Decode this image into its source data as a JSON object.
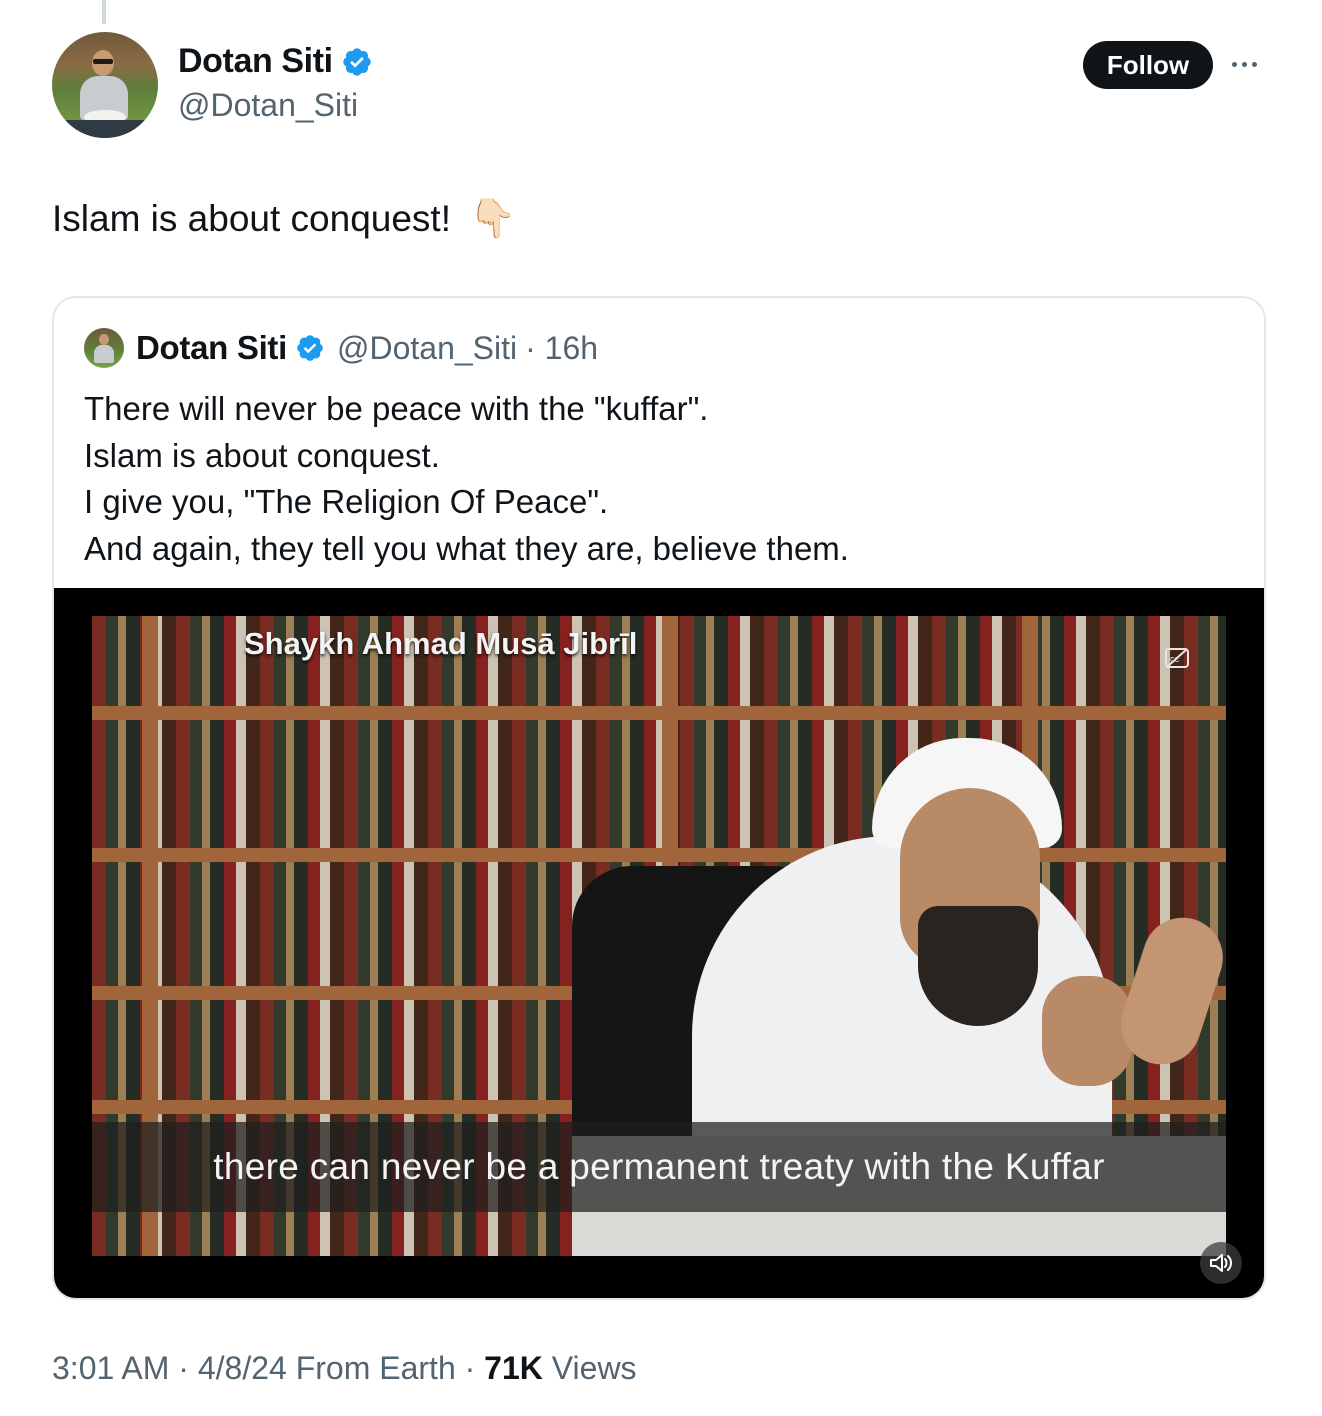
{
  "post": {
    "author": {
      "display_name": "Dotan Siti",
      "handle": "@Dotan_Siti"
    },
    "follow_label": "Follow",
    "text": "Islam is about conquest!",
    "emoji": "👇🏻"
  },
  "quoted": {
    "author": {
      "display_name": "Dotan Siti",
      "handle": "@Dotan_Siti",
      "age": "· 16h"
    },
    "lines": [
      "There will never be peace with the \"kuffar\".",
      "Islam is about conquest.",
      "I give you, \"The Religion Of Peace\".",
      "And again, they tell you what they are, believe them."
    ],
    "video": {
      "overlay_name": "Shaykh Ahmad Musā Jibrīl",
      "subtitle": "there can never be a permanent treaty with the Kuffar"
    }
  },
  "meta": {
    "time": "3:01 AM · 4/8/24 From Earth · ",
    "views_count": "71K",
    "views_label": " Views"
  },
  "colors": {
    "verified": "#1d9bf0",
    "secondary_text": "#536471",
    "follow_bg": "#0f1419"
  }
}
